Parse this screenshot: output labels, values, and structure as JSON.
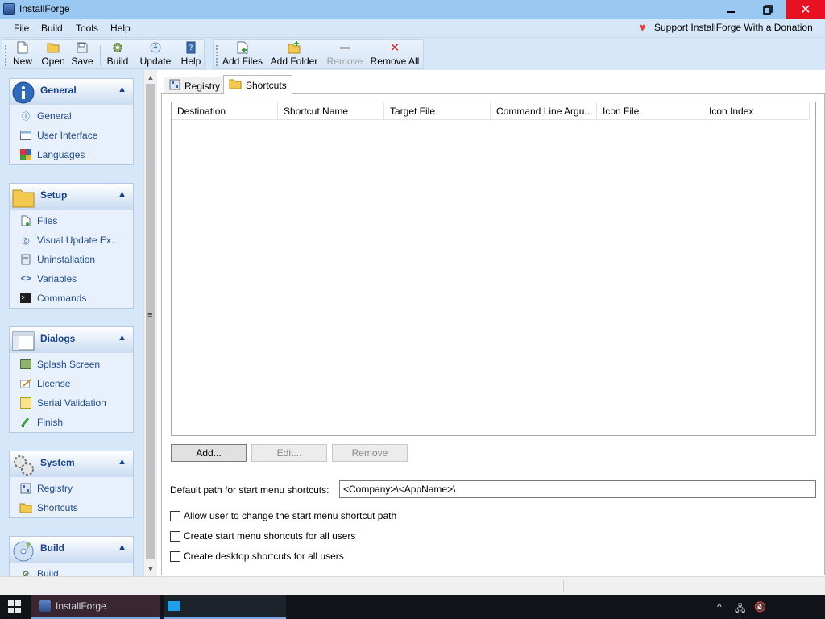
{
  "window": {
    "title": "InstallForge"
  },
  "menu": {
    "items": [
      "File",
      "Build",
      "Tools",
      "Help"
    ],
    "donate": "Support InstallForge With a Donation"
  },
  "toolbar": {
    "new": "New",
    "open": "Open",
    "save": "Save",
    "build": "Build",
    "update": "Update",
    "help": "Help",
    "add_files": "Add Files",
    "add_folder": "Add Folder",
    "remove": "Remove",
    "remove_all": "Remove All"
  },
  "sidebar": {
    "general": {
      "title": "General",
      "items": [
        "General",
        "User Interface",
        "Languages"
      ]
    },
    "setup": {
      "title": "Setup",
      "items": [
        "Files",
        "Visual Update Ex...",
        "Uninstallation",
        "Variables",
        "Commands"
      ]
    },
    "dialogs": {
      "title": "Dialogs",
      "items": [
        "Splash Screen",
        "License",
        "Serial Validation",
        "Finish"
      ]
    },
    "system": {
      "title": "System",
      "items": [
        "Registry",
        "Shortcuts"
      ]
    },
    "build": {
      "title": "Build",
      "items": [
        "Build"
      ]
    }
  },
  "tabs": {
    "registry": "Registry",
    "shortcuts": "Shortcuts"
  },
  "grid": {
    "columns": [
      "Destination",
      "Shortcut Name",
      "Target File",
      "Command Line Argu...",
      "Icon File",
      "Icon Index"
    ]
  },
  "buttons": {
    "add": "Add...",
    "edit": "Edit...",
    "remove": "Remove"
  },
  "form": {
    "default_path_label": "Default path for start menu shortcuts:",
    "default_path_value": "<Company>\\<AppName>\\",
    "check_allow_change": "Allow user to change the start menu shortcut path",
    "check_all_users_start": "Create start menu shortcuts for all users",
    "check_all_users_desktop": "Create desktop shortcuts for all users"
  },
  "taskbar": {
    "task_label": "InstallForge"
  },
  "colors": {
    "accent": "#99c9f2",
    "close": "#e81123",
    "link": "#1f4b8e"
  }
}
